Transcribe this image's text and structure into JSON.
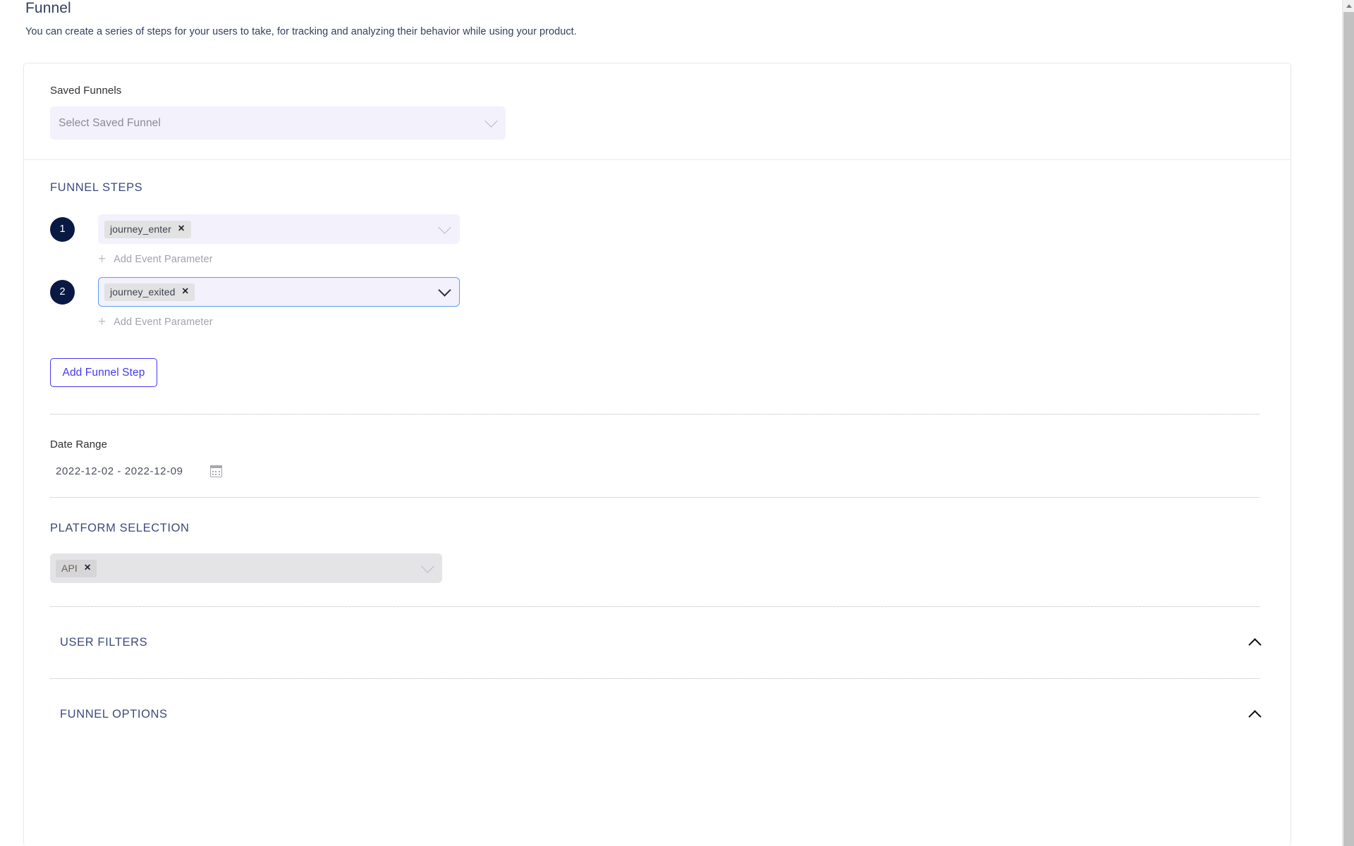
{
  "top_indicator": {
    "name": "tab-progress-indicator",
    "color": "#0071c5",
    "track_color": "#e3e3e3"
  },
  "header": {
    "title": "Funnel",
    "subtitle": "You can create a series of steps for your users to take, for tracking and analyzing their behavior while using your product."
  },
  "saved_funnels": {
    "label": "Saved Funnels",
    "placeholder": "Select Saved Funnel",
    "value": ""
  },
  "funnel_steps": {
    "heading": "FUNNEL STEPS",
    "steps": [
      {
        "number": "1",
        "event": "journey_enter",
        "remove_label": "✕",
        "focused": false,
        "add_parameter_label": "Add Event Parameter",
        "add_parameter_plus": "+"
      },
      {
        "number": "2",
        "event": "journey_exited",
        "remove_label": "✕",
        "focused": true,
        "add_parameter_label": "Add Event Parameter",
        "add_parameter_plus": "+"
      }
    ],
    "add_step_label": "Add Funnel Step"
  },
  "date_range": {
    "label": "Date Range",
    "start": "2022-12-02",
    "separator": "-",
    "end": "2022-12-09",
    "display": "2022-12-02  -  2022-12-09",
    "icon": "calendar-icon"
  },
  "platform_selection": {
    "heading": "PLATFORM SELECTION",
    "tags": [
      {
        "label": "API",
        "remove_label": "✕"
      }
    ]
  },
  "user_filters": {
    "heading": "USER FILTERS",
    "expanded": true,
    "toggle_icon": "chevron-up-icon"
  },
  "funnel_options": {
    "heading": "FUNNEL OPTIONS",
    "expanded": true,
    "toggle_icon": "chevron-up-icon"
  },
  "colors": {
    "accent_blue": "#4339f2",
    "heading_blue": "#3c4a7c",
    "step_badge": "#081944",
    "select_bg": "#f3f1fc",
    "platform_bg": "#e4e4e6",
    "focus_border": "#5aa1e8"
  }
}
